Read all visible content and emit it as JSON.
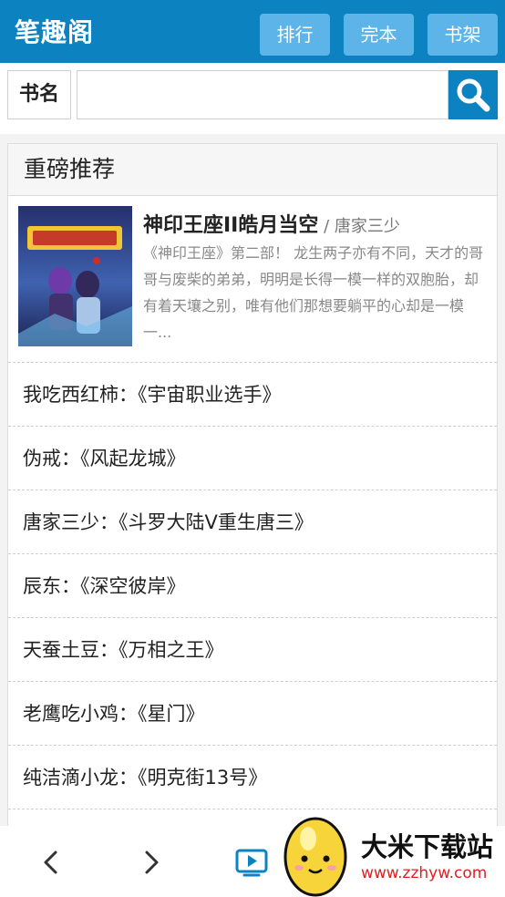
{
  "header": {
    "logo": "笔趣阁",
    "nav": [
      {
        "label": "排行"
      },
      {
        "label": "完本"
      },
      {
        "label": "书架"
      }
    ]
  },
  "search": {
    "label": "书名",
    "value": "",
    "placeholder": "",
    "button_icon": "search-icon"
  },
  "recommend": {
    "heading": "重磅推荐",
    "featured": {
      "title": "神印王座II皓月当空",
      "author": " / 唐家三少",
      "description": "《神印王座》第二部！ 龙生两子亦有不同，天才的哥哥与废柴的弟弟，明明是长得一模一样的双胞胎，却有着天壤之别，唯有他们那想要躺平的心却是一模一..."
    },
    "items": [
      {
        "text": "我吃西红柿：《宇宙职业选手》"
      },
      {
        "text": "伪戒：《风起龙城》"
      },
      {
        "text": "唐家三少：《斗罗大陆V重生唐三》"
      },
      {
        "text": "辰东：《深空彼岸》"
      },
      {
        "text": "天蚕土豆：《万相之王》"
      },
      {
        "text": "老鹰吃小鸡：《星门》"
      },
      {
        "text": "纯洁滴小龙：《明克街13号》"
      }
    ]
  },
  "bottom_bar": {
    "icons": [
      "back-arrow-icon",
      "forward-arrow-icon",
      "video-icon"
    ]
  },
  "watermark": {
    "name": "大米下载站",
    "url": "www.zzhyw.com"
  },
  "colors": {
    "brand": "#0c82c1",
    "nav_button": "#5cb4e8",
    "watermark_url": "#e02020"
  }
}
